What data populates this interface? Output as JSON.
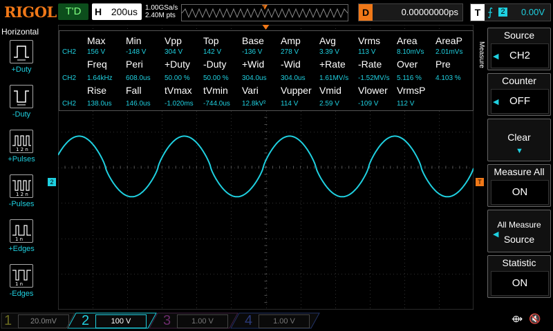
{
  "header": {
    "logo": "RIGOL",
    "trigger_status": "T'D",
    "timebase_label": "H",
    "timebase_value": "200us",
    "sample_rate": "1.00GSa/s",
    "memory_depth": "2.40M pts",
    "delay_label": "D",
    "delay_value": "0.00000000ps",
    "trigger_label": "T",
    "trigger_source": "2",
    "trigger_level": "0.00V"
  },
  "left_panel": {
    "title": "Horizontal",
    "items": [
      {
        "label": "+Duty",
        "icon": "positive-duty-icon"
      },
      {
        "label": "-Duty",
        "icon": "negative-duty-icon"
      },
      {
        "label": "+Pulses",
        "icon": "positive-pulses-icon"
      },
      {
        "label": "-Pulses",
        "icon": "negative-pulses-icon"
      },
      {
        "label": "+Edges",
        "icon": "positive-edges-icon"
      },
      {
        "label": "-Edges",
        "icon": "negative-edges-icon"
      }
    ]
  },
  "measurements": {
    "rows": [
      {
        "type": "header",
        "cells": [
          "Max",
          "Min",
          "Vpp",
          "Top",
          "Base",
          "Amp",
          "Avg",
          "Vrms",
          "Area",
          "AreaP"
        ]
      },
      {
        "type": "values",
        "channel": "CH2",
        "cells": [
          "156 V",
          "-148 V",
          "304 V",
          "142 V",
          "-136 V",
          "278 V",
          "3.39 V",
          "113 V",
          "8.10mVs",
          "2.01mVs"
        ]
      },
      {
        "type": "header",
        "cells": [
          "Freq",
          "Peri",
          "+Duty",
          "-Duty",
          "+Wid",
          "-Wid",
          "+Rate",
          "-Rate",
          "Over",
          "Pre"
        ]
      },
      {
        "type": "values",
        "channel": "CH2",
        "cells": [
          "1.64kHz",
          "608.0us",
          "50.00 %",
          "50.00 %",
          "304.0us",
          "304.0us",
          "1.61MV/s",
          "-1.52MV/s",
          "5.116 %",
          "4.103 %"
        ]
      },
      {
        "type": "header",
        "cells": [
          "Rise",
          "Fall",
          "tVmax",
          "tVmin",
          "Vari",
          "Vupper",
          "Vmid",
          "Vlower",
          "VrmsP",
          ""
        ]
      },
      {
        "type": "values",
        "channel": "CH2",
        "cells": [
          "138.0us",
          "146.0us",
          "-1.020ms",
          "-744.0us",
          "12.8kV²",
          "114 V",
          "2.59 V",
          "-109 V",
          "112 V",
          ""
        ]
      }
    ]
  },
  "right_panel": {
    "menu_title": "Measure",
    "items": [
      {
        "title": "Source",
        "value": "CH2"
      },
      {
        "title": "Counter",
        "value": "OFF"
      },
      {
        "title": "Clear",
        "value": ""
      },
      {
        "title": "Measure All",
        "value": "ON"
      },
      {
        "title": "All Measure",
        "value": "Source"
      },
      {
        "title": "Statistic",
        "value": "ON"
      }
    ]
  },
  "channels": [
    {
      "num": "1",
      "scale": "20.0mV",
      "color": "#c8c800"
    },
    {
      "num": "2",
      "scale": "100 V",
      "color": "#1fd0e0"
    },
    {
      "num": "3",
      "scale": "1.00 V",
      "color": "#c020c0"
    },
    {
      "num": "4",
      "scale": "1.00 V",
      "color": "#3050ff"
    }
  ],
  "markers": {
    "ch2_ground": "2",
    "trigger_level_marker": "T"
  },
  "colors": {
    "accent": "#f07818",
    "ch2": "#1fd0e0",
    "grid": "#333333"
  }
}
